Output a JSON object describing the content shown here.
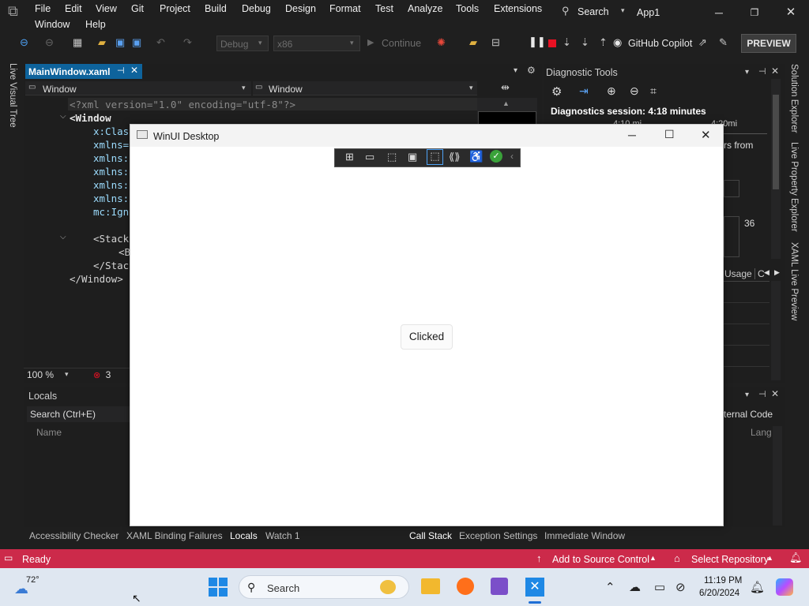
{
  "menu": {
    "row1": [
      "File",
      "Edit",
      "View",
      "Git",
      "Project",
      "Build",
      "Debug",
      "Design",
      "Format",
      "Test",
      "Analyze",
      "Tools",
      "Extensions"
    ],
    "row2": [
      "Window",
      "Help"
    ],
    "search": "Search",
    "solution": "App1"
  },
  "toolbar": {
    "config": "Debug",
    "platform": "x86",
    "continue": "Continue",
    "copilot": "GitHub Copilot",
    "preview": "PREVIEW"
  },
  "editor": {
    "tab": "MainWindow.xaml",
    "dropdown_left": "Window",
    "dropdown_right": "Window",
    "lines": [
      "<?xml version=\"1.0\" encoding=\"utf-8\"?>",
      "<Window",
      "x:Clas",
      "xmlns=",
      "xmlns:",
      "xmlns:",
      "xmlns:",
      "xmlns:",
      "mc:Ign",
      "<Stack",
      "<B",
      "</Stac",
      "</Window>"
    ],
    "zoom": "100 %",
    "errors": "3"
  },
  "diagnostic": {
    "title": "Diagnostic Tools",
    "session": "Diagnostics session: 4:18 minutes",
    "t1": "4:10 mi",
    "t2": "4:20mi",
    "snippet": "rs from",
    "value": "36",
    "usage_tab": "Usage",
    "c_tab": "C"
  },
  "locals": {
    "title": "Locals",
    "search": "Search (Ctrl+E)",
    "col_name": "Name",
    "col_lang": "Lang",
    "external": "ternal Code"
  },
  "bottom_tabs_left": [
    "Accessibility Checker",
    "XAML Binding Failures",
    "Locals",
    "Watch 1"
  ],
  "bottom_tabs_right": [
    "Call Stack",
    "Exception Settings",
    "Immediate Window"
  ],
  "side_tabs_left": [
    "Live Visual Tree"
  ],
  "side_tabs_right": [
    "Solution Explorer",
    "Live Property Explorer",
    "XAML Live Preview"
  ],
  "app_window": {
    "title": "WinUI Desktop",
    "button_text": "Clicked"
  },
  "status": {
    "ready": "Ready",
    "source_control": "Add to Source Control",
    "repo": "Select Repository"
  },
  "taskbar": {
    "temp": "72°",
    "search": "Search",
    "time": "11:19 PM",
    "date": "6/20/2024"
  },
  "colors": {
    "accent": "#0e639c",
    "status_bar": "#cc2a4a",
    "stop_red": "#e81123"
  }
}
